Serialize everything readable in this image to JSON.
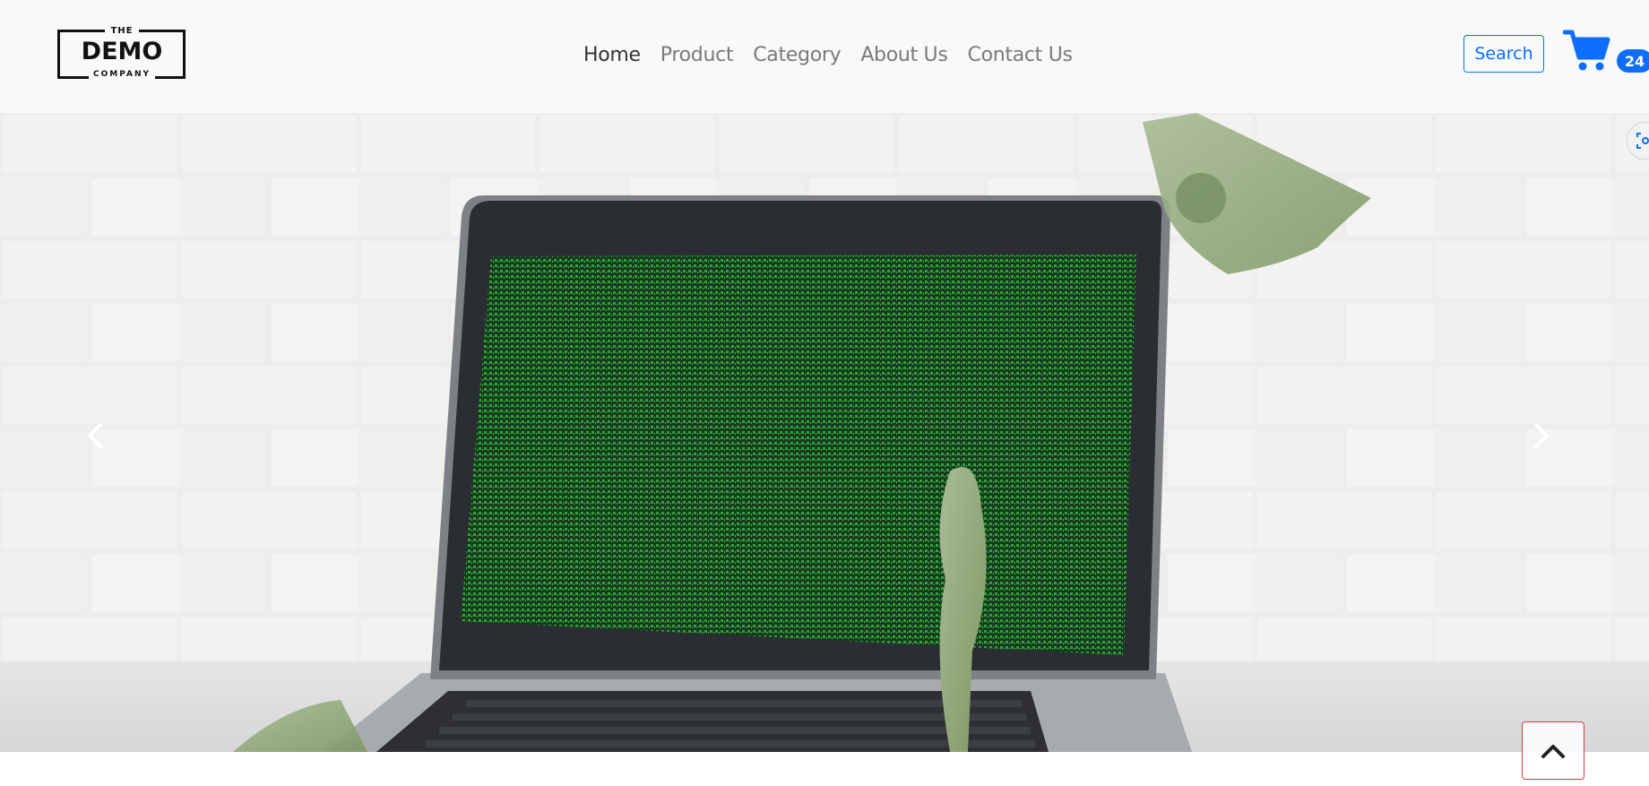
{
  "logo": {
    "top_text": "THE",
    "main_text": "DEMO",
    "bottom_text": "COMPANY"
  },
  "nav": {
    "links": [
      {
        "label": "Home",
        "active": true
      },
      {
        "label": "Product",
        "active": false
      },
      {
        "label": "Category",
        "active": false
      },
      {
        "label": "About Us",
        "active": false
      },
      {
        "label": "Contact Us",
        "active": false
      }
    ]
  },
  "header": {
    "search_label": "Search",
    "cart_count": "24"
  },
  "hero": {
    "image_description_icon": "laptop-with-falling-money",
    "prev_icon": "chevron-left-icon",
    "next_icon": "chevron-right-icon"
  },
  "colors": {
    "primary": "#0d6efd",
    "navbar_bg": "#f8f9fa",
    "back_to_top_border": "#dc3545",
    "screen_green": "#2fa33a"
  },
  "icons": {
    "cart": "shopping-cart-icon",
    "back_to_top": "chevron-up-icon",
    "scan": "scan-icon"
  }
}
